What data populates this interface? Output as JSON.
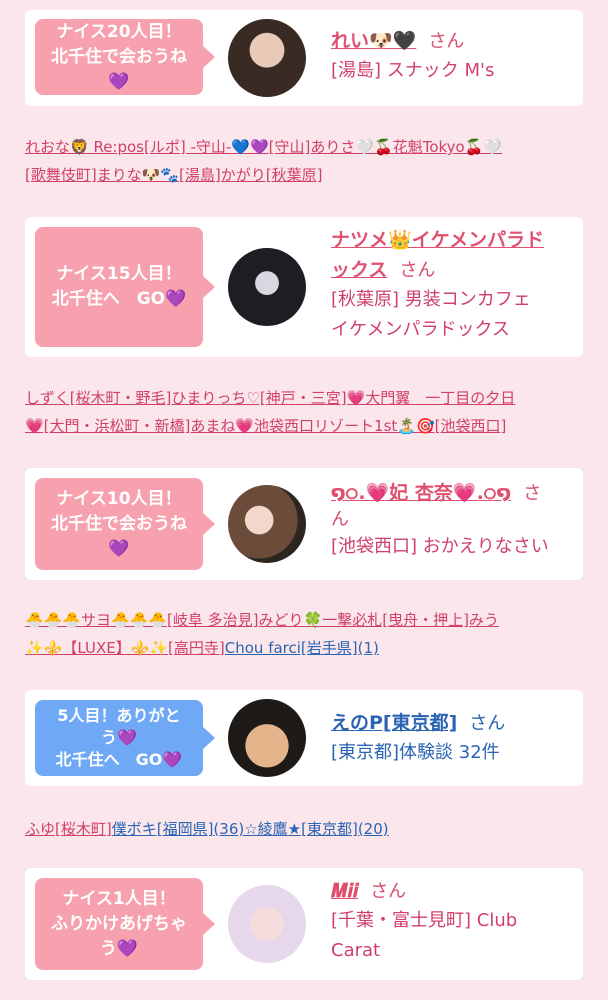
{
  "cards": [
    {
      "bubble": [
        "ナイス20人目！",
        "北千住で会おうね",
        "💜"
      ],
      "name": "れい🐶🖤",
      "san": "さん",
      "shop_lines": [
        "[湯島] スナック M's"
      ]
    },
    {
      "bubble": [
        "ナイス15人目！",
        "北千住へ　GO💜"
      ],
      "name_lines": [
        "ナツメ👑イケメンパラド",
        "ックス"
      ],
      "san": "さん",
      "shop_lines": [
        "[秋葉原] 男装コンカフェ",
        "イケメンパラドックス"
      ]
    },
    {
      "bubble": [
        "ナイス10人目！",
        "北千住で会おうね",
        "💜"
      ],
      "name_lines": [
        "໑੦.💗妃 杏奈💗.੦໑",
        ""
      ],
      "san": "さ",
      "san2": "ん",
      "shop_lines": [
        "[池袋西口] おかえりなさい"
      ]
    },
    {
      "bubble": [
        "5人目！ありがと",
        "う💜",
        "北千住へ　GO💜"
      ],
      "name": "えのP[東京都]",
      "san": "さん",
      "shop_lines": [
        "[東京都]体験談 32件"
      ]
    },
    {
      "bubble": [
        "ナイス1人目！",
        "ふりかけあげちゃ",
        "う💜"
      ],
      "name": "𝑴𝒊𝒊",
      "san": "さん",
      "shop_lines": [
        "[千葉・富士見町] Club",
        "Carat"
      ]
    }
  ],
  "links1": {
    "line1": "れおな🦁 Re:pos[ルポ] -守山-💙💜[守山]ありさ🤍🍒花魁Tokyo🍒🤍",
    "line2": "[歌舞伎町]まりな🐶🐾[湯島]かがり[秋葉原]"
  },
  "links2": {
    "line1": "しずく[桜木町・野毛]ひまりっち♡[神戸・三宮]💗大門翼　一丁目の夕日",
    "line2": "💗[大門・浜松町・新橋]あまね💗池袋西口リゾート1st🏝️🎯[池袋西口]"
  },
  "links3": {
    "line1": "🐣🐣🐣サヨ🐣🐣🐣[岐阜 多治見]みどり🍀一撃必札[曳舟・押上]みう",
    "line2a": "✨⚜️【LUXE】⚜️✨[高円寺]",
    "line2b": "Chou farci[岩手県](1)"
  },
  "links4": {
    "part_a": "ふゆ[桜木町]",
    "part_b": "僕ボキ[福岡県](36)☆綾鷹★[東京都](20)"
  }
}
